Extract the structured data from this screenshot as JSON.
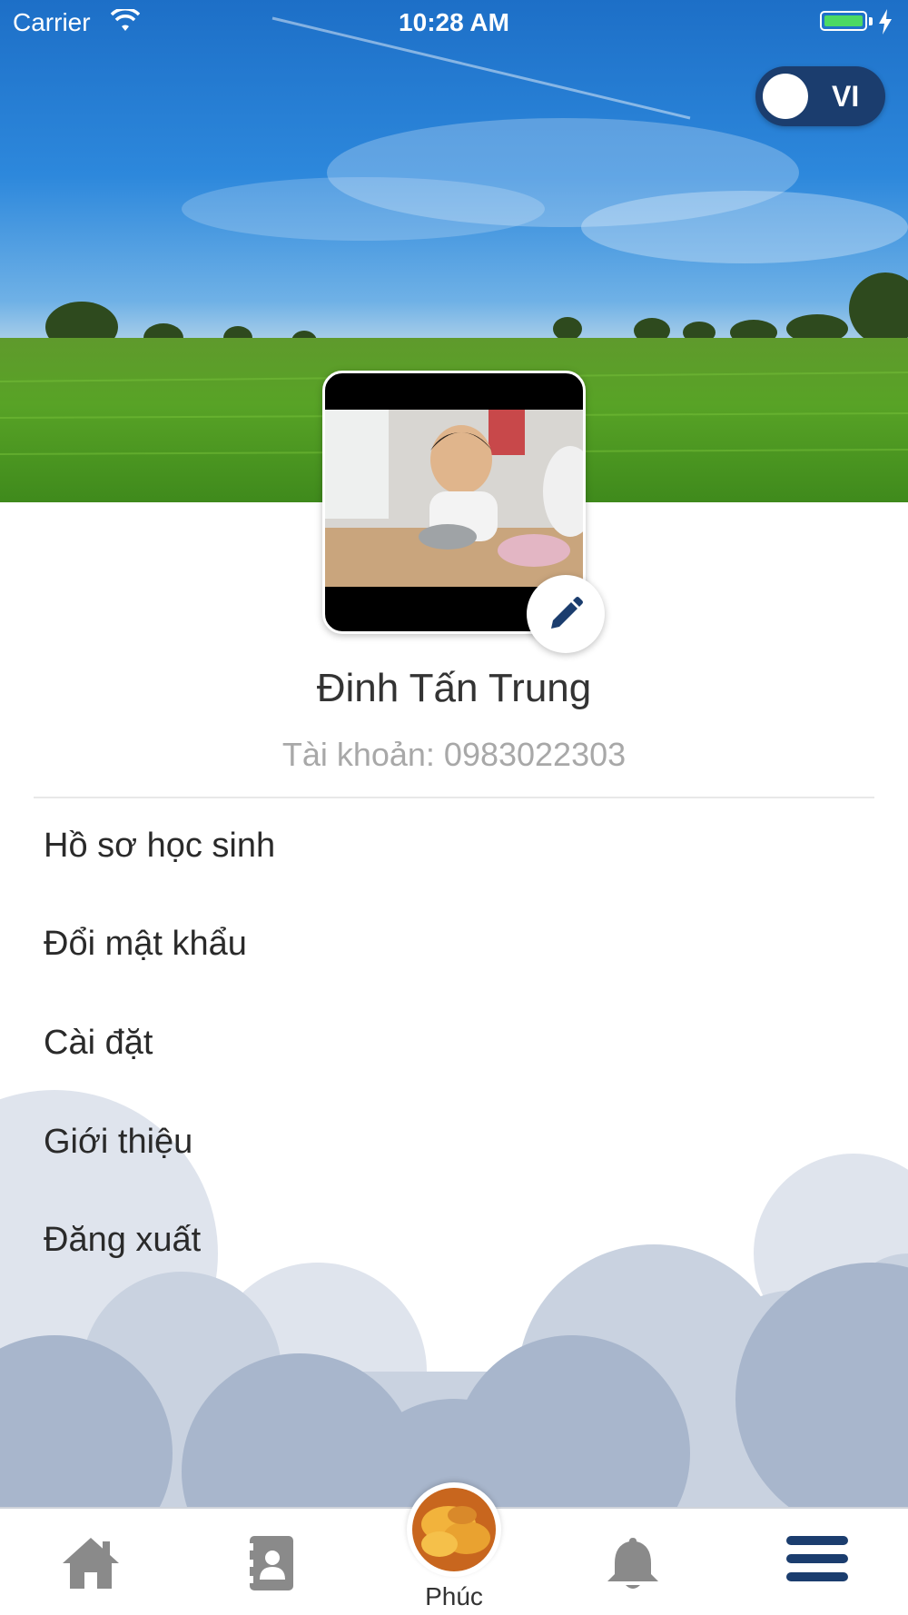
{
  "status_bar": {
    "carrier": "Carrier",
    "time": "10:28 AM"
  },
  "language_toggle": {
    "label": "VI"
  },
  "profile": {
    "name": "Đinh Tấn Trung",
    "account": "Tài khoản: 0983022303"
  },
  "menu": {
    "items": [
      {
        "label": "Hồ sơ học sinh"
      },
      {
        "label": "Đổi mật khẩu"
      },
      {
        "label": "Cài đặt"
      },
      {
        "label": "Giới thiệu"
      },
      {
        "label": "Đăng xuất"
      }
    ]
  },
  "tabbar": {
    "center_label": "Phúc",
    "tabs": [
      {
        "icon": "home-icon"
      },
      {
        "icon": "contacts-icon"
      },
      {
        "icon": "student-avatar"
      },
      {
        "icon": "bell-icon"
      },
      {
        "icon": "menu-icon"
      }
    ],
    "active_color": "#1b3d6e",
    "inactive_color": "#8a8a8a"
  },
  "colors": {
    "accent": "#1b3d6e",
    "battery": "#4cd964"
  }
}
